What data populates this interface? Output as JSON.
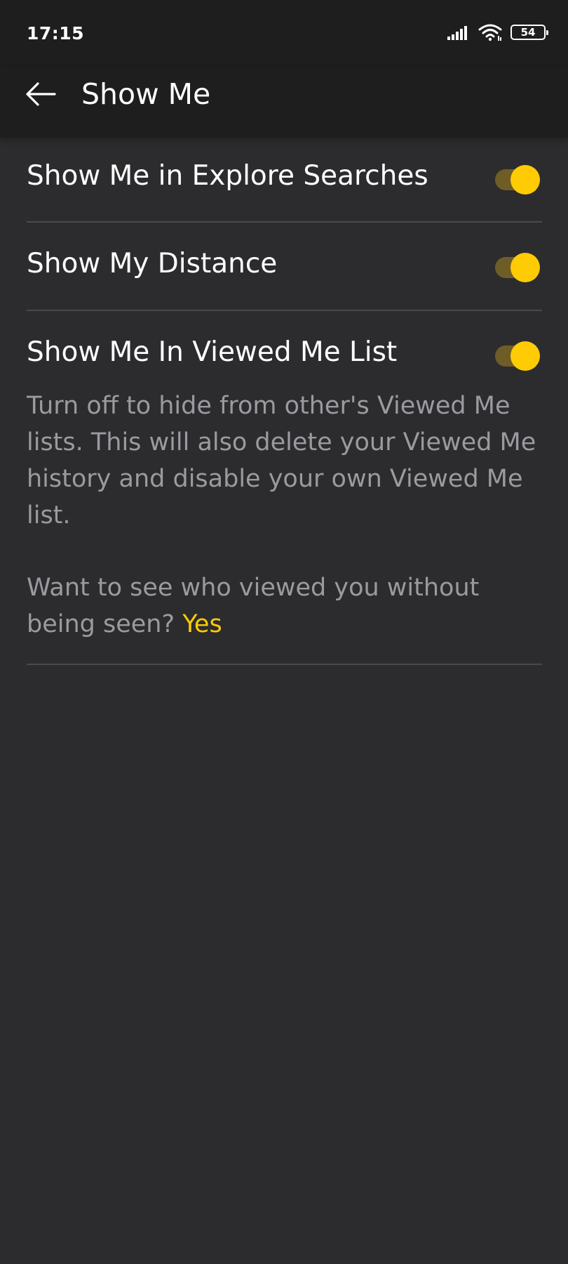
{
  "status_bar": {
    "time": "17:15",
    "battery_level": "54",
    "icons": [
      "signal-icon",
      "wifi-icon",
      "battery-icon"
    ]
  },
  "header": {
    "title": "Show Me",
    "back_icon": "arrow-left-icon"
  },
  "settings": [
    {
      "label": "Show Me in Explore Searches",
      "enabled": true
    },
    {
      "label": "Show My Distance",
      "enabled": true
    },
    {
      "label": "Show Me In Viewed Me List",
      "enabled": true
    }
  ],
  "viewed_me_description": "Turn off to hide from other's Viewed Me lists. This will also delete your Viewed Me history and disable your own Viewed Me list.",
  "incognito_prompt": {
    "text": "Want to see who viewed you without being seen?",
    "link": "Yes"
  },
  "colors": {
    "background": "#2c2c2e",
    "header": "#1e1e1e",
    "accent": "#ffcb05",
    "secondary_text": "#9a9aa0"
  }
}
